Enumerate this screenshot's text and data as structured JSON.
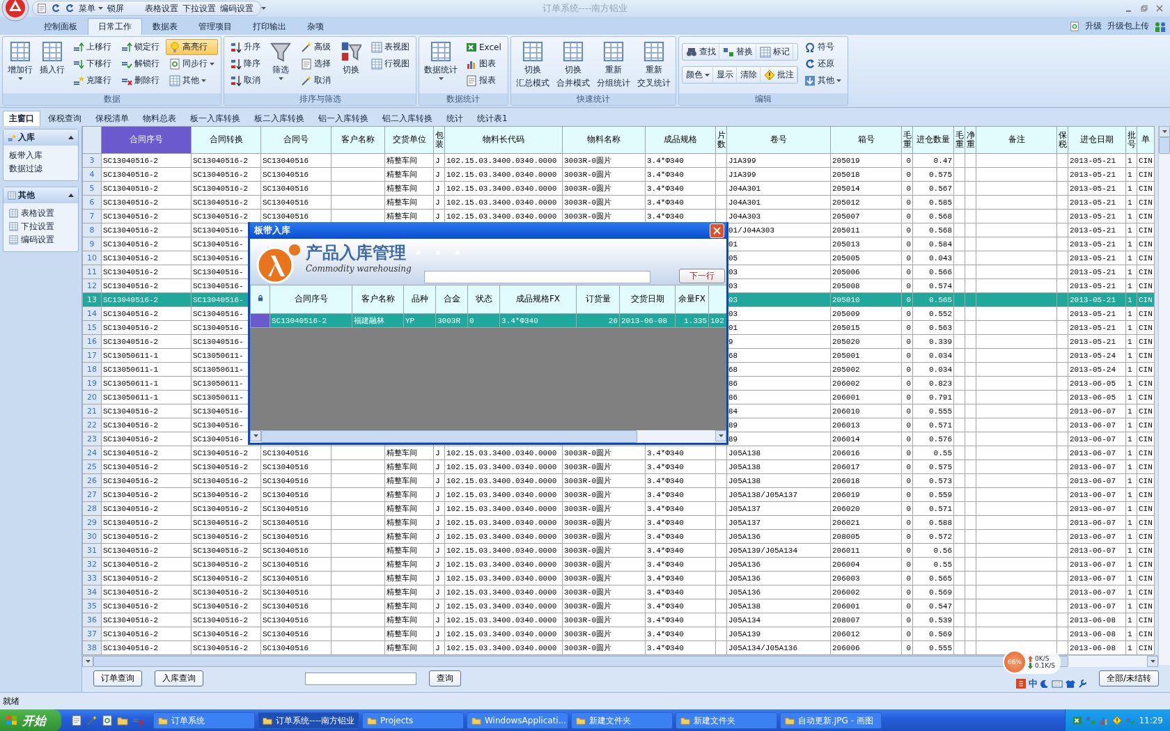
{
  "window": {
    "title": "订单系统----南方铝业"
  },
  "quick_access": [
    {
      "label": "菜单",
      "dropdown": true
    },
    {
      "label": "锁屏",
      "dropdown": false
    },
    {
      "label": "表格设置",
      "dropdown": false
    },
    {
      "label": "下拉设置",
      "dropdown": false
    },
    {
      "label": "编码设置",
      "dropdown": false
    }
  ],
  "menu_tabs": [
    {
      "label": "控制面板",
      "selected": false
    },
    {
      "label": "日常工作",
      "selected": true
    },
    {
      "label": "数据表",
      "selected": false
    },
    {
      "label": "管理项目",
      "selected": false
    },
    {
      "label": "打印输出",
      "selected": false
    },
    {
      "label": "杂项",
      "selected": false
    }
  ],
  "top_right": [
    "升级",
    "升级包上传"
  ],
  "ribbon": [
    {
      "title": "数据",
      "columns": [
        {
          "kind": "large",
          "lines": [
            "增加行"
          ],
          "dropdown": true
        },
        {
          "kind": "large",
          "lines": [
            "插入行"
          ],
          "dropdown": false
        },
        {
          "kind": "stack",
          "items": [
            {
              "label": "上移行",
              "on": false,
              "dropdown": false
            },
            {
              "label": "下移行",
              "on": false,
              "dropdown": false
            },
            {
              "label": "克隆行",
              "on": false,
              "dropdown": false
            }
          ]
        },
        {
          "kind": "stack",
          "items": [
            {
              "label": "锁定行",
              "on": false,
              "dropdown": false
            },
            {
              "label": "解锁行",
              "on": false,
              "dropdown": false
            },
            {
              "label": "删除行",
              "on": false,
              "dropdown": false
            }
          ]
        },
        {
          "kind": "stack",
          "items": [
            {
              "label": "高亮行",
              "on": true,
              "dropdown": false
            },
            {
              "label": "同步行",
              "on": false,
              "dropdown": true
            },
            {
              "label": "其他",
              "on": false,
              "dropdown": true
            }
          ]
        }
      ]
    },
    {
      "title": "排序与筛选",
      "columns": [
        {
          "kind": "stack",
          "items": [
            {
              "label": "升序",
              "on": false,
              "dropdown": false
            },
            {
              "label": "降序",
              "on": false,
              "dropdown": false
            },
            {
              "label": "取消",
              "on": false,
              "dropdown": false
            }
          ]
        },
        {
          "kind": "large",
          "lines": [
            "筛选"
          ],
          "dropdown": true
        },
        {
          "kind": "stack",
          "items": [
            {
              "label": "高级",
              "on": false,
              "dropdown": false
            },
            {
              "label": "选择",
              "on": false,
              "dropdown": false
            },
            {
              "label": "取消",
              "on": false,
              "dropdown": false
            }
          ]
        },
        {
          "kind": "large",
          "lines": [
            "切换"
          ],
          "dropdown": false
        },
        {
          "kind": "stack",
          "items": [
            {
              "label": "表视图",
              "on": false,
              "dropdown": false
            },
            {
              "label": "行视图",
              "on": false,
              "dropdown": false
            }
          ]
        }
      ]
    },
    {
      "title": "数据统计",
      "columns": [
        {
          "kind": "large",
          "lines": [
            "数据统计"
          ],
          "dropdown": true
        },
        {
          "kind": "stack",
          "items": [
            {
              "label": "Excel",
              "on": false,
              "dropdown": false
            },
            {
              "label": "图表",
              "on": false,
              "dropdown": false
            },
            {
              "label": "报表",
              "on": false,
              "dropdown": false
            }
          ]
        }
      ]
    },
    {
      "title": "快速统计",
      "columns": [
        {
          "kind": "large",
          "lines": [
            "切换",
            "汇总模式"
          ],
          "dropdown": false
        },
        {
          "kind": "large",
          "lines": [
            "切换",
            "合并模式"
          ],
          "dropdown": false
        },
        {
          "kind": "large",
          "lines": [
            "重新",
            "分组统计"
          ],
          "dropdown": false
        },
        {
          "kind": "large",
          "lines": [
            "重新",
            "交叉统计"
          ],
          "dropdown": false
        }
      ]
    },
    {
      "title": "编辑",
      "columns": [
        {
          "kind": "strips",
          "strips": [
            {
              "items": [
                {
                  "label": "查找",
                  "dropdown": false
                },
                {
                  "label": "替换",
                  "dropdown": false
                },
                {
                  "label": "标记",
                  "dropdown": false
                }
              ]
            },
            {
              "items": [
                {
                  "label": "颜色",
                  "dropdown": true
                },
                {
                  "label": "显示",
                  "dropdown": false
                },
                {
                  "label": "清除",
                  "dropdown": false
                },
                {
                  "label": "批注",
                  "dropdown": false
                }
              ]
            }
          ]
        },
        {
          "kind": "stack",
          "items": [
            {
              "label": "符号",
              "on": false,
              "dropdown": false
            },
            {
              "label": "还原",
              "on": false,
              "dropdown": false
            },
            {
              "label": "其他",
              "on": false,
              "dropdown": true
            }
          ]
        }
      ]
    }
  ],
  "doc_tabs": [
    {
      "label": "主窗口",
      "selected": true
    },
    {
      "label": "保税查询",
      "selected": false
    },
    {
      "label": "保税清单",
      "selected": false
    },
    {
      "label": "物料总表",
      "selected": false
    },
    {
      "label": "板一入库转换",
      "selected": false
    },
    {
      "label": "板二入库转换",
      "selected": false
    },
    {
      "label": "铝一入库转换",
      "selected": false
    },
    {
      "label": "铝二入库转换",
      "selected": false
    },
    {
      "label": "统计",
      "selected": false
    },
    {
      "label": "统计表1",
      "selected": false
    }
  ],
  "sidebar": [
    {
      "title": "入库",
      "kind": "plain",
      "items": [
        "板带入库",
        "数据过滤"
      ]
    },
    {
      "title": "其他",
      "kind": "icons",
      "items": [
        "表格设置",
        "下拉设置",
        "编码设置"
      ]
    }
  ],
  "table": {
    "columns": [
      {
        "label": "合同序号",
        "selected": true
      },
      {
        "label": "合同转换",
        "selected": false
      },
      {
        "label": "合同号",
        "selected": false
      },
      {
        "label": "客户名称",
        "selected": false
      },
      {
        "label": "交货单位",
        "selected": false
      },
      {
        "label": "包装",
        "selected": false
      },
      {
        "label": "物料长代码",
        "selected": false
      },
      {
        "label": "物料名称",
        "selected": false
      },
      {
        "label": "成品规格",
        "selected": false
      },
      {
        "label": "片数",
        "selected": false
      },
      {
        "label": "卷号",
        "selected": false
      },
      {
        "label": "箱号",
        "selected": false
      },
      {
        "label": "毛重",
        "selected": false
      },
      {
        "label": "进仓数量",
        "selected": false
      },
      {
        "label": "毛重",
        "selected": false
      },
      {
        "label": "净重",
        "selected": false
      },
      {
        "label": "备注",
        "selected": false
      },
      {
        "label": "保税",
        "selected": false
      },
      {
        "label": "进仓日期",
        "selected": false
      },
      {
        "label": "批号",
        "selected": false
      },
      {
        "label": "单",
        "selected": false
      }
    ],
    "rows": [
      {
        "n": "3",
        "selected": false,
        "cells": [
          "SC13040516-2",
          "SC13040516-2",
          "SC13040516",
          null,
          "精整车间",
          "J",
          "102.15.03.3400.0340.0000",
          "3003R-0圆片",
          "3.4*Φ340",
          null,
          "J1A399",
          "205019",
          "0",
          "0.47",
          null,
          null,
          null,
          null,
          "2013-05-21",
          "1",
          "CIN"
        ]
      },
      {
        "n": "4",
        "selected": false,
        "cells": [
          "SC13040516-2",
          "SC13040516-2",
          "SC13040516",
          null,
          "精整车间",
          "J",
          "102.15.03.3400.0340.0000",
          "3003R-0圆片",
          "3.4*Φ340",
          null,
          "J1A399",
          "205018",
          "0",
          "0.575",
          null,
          null,
          null,
          null,
          "2013-05-21",
          "1",
          "CIN"
        ]
      },
      {
        "n": "5",
        "selected": false,
        "cells": [
          "SC13040516-2",
          "SC13040516-2",
          "SC13040516",
          null,
          "精整车间",
          "J",
          "102.15.03.3400.0340.0000",
          "3003R-0圆片",
          "3.4*Φ340",
          null,
          "J04A301",
          "205014",
          "0",
          "0.567",
          null,
          null,
          null,
          null,
          "2013-05-21",
          "1",
          "CIN"
        ]
      },
      {
        "n": "6",
        "selected": false,
        "cells": [
          "SC13040516-2",
          "SC13040516-2",
          "SC13040516",
          null,
          "精整车间",
          "J",
          "102.15.03.3400.0340.0000",
          "3003R-0圆片",
          "3.4*Φ340",
          null,
          "J04A301",
          "205012",
          "0",
          "0.585",
          null,
          null,
          null,
          null,
          "2013-05-21",
          "1",
          "CIN"
        ]
      },
      {
        "n": "7",
        "selected": false,
        "cells": [
          "SC13040516-2",
          "SC13040516-2",
          "SC13040516",
          null,
          "精整车间",
          "J",
          "102.15.03.3400.0340.0000",
          "3003R-0圆片",
          "3.4*Φ340",
          null,
          "J04A303",
          "205007",
          "0",
          "0.568",
          null,
          null,
          null,
          null,
          "2013-05-21",
          "1",
          "CIN"
        ]
      },
      {
        "n": "8",
        "selected": false,
        "cells": [
          "SC13040516-2",
          "SC13040516-",
          null,
          null,
          null,
          null,
          null,
          null,
          null,
          null,
          "01/J04A303",
          "205011",
          "0",
          "0.568",
          null,
          null,
          null,
          null,
          "2013-05-21",
          "1",
          "CIN"
        ]
      },
      {
        "n": "9",
        "selected": false,
        "cells": [
          "SC13040516-2",
          "SC13040516-",
          null,
          null,
          null,
          null,
          null,
          null,
          null,
          null,
          "01",
          "205013",
          "0",
          "0.584",
          null,
          null,
          null,
          null,
          "2013-05-21",
          "1",
          "CIN"
        ]
      },
      {
        "n": "10",
        "selected": false,
        "cells": [
          "SC13040516-2",
          "SC13040516-",
          null,
          null,
          null,
          null,
          null,
          null,
          null,
          null,
          "05",
          "205005",
          "0",
          "0.043",
          null,
          null,
          null,
          null,
          "2013-05-21",
          "1",
          "CIN"
        ]
      },
      {
        "n": "11",
        "selected": false,
        "cells": [
          "SC13040516-2",
          "SC13040516-",
          null,
          null,
          null,
          null,
          null,
          null,
          null,
          null,
          "03",
          "205006",
          "0",
          "0.566",
          null,
          null,
          null,
          null,
          "2013-05-21",
          "1",
          "CIN"
        ]
      },
      {
        "n": "12",
        "selected": false,
        "cells": [
          "SC13040516-2",
          "SC13040516-",
          null,
          null,
          null,
          null,
          null,
          null,
          null,
          null,
          "03",
          "205008",
          "0",
          "0.574",
          null,
          null,
          null,
          null,
          "2013-05-21",
          "1",
          "CIN"
        ]
      },
      {
        "n": "13",
        "selected": true,
        "cells": [
          "SC13040516-2",
          "SC13040516-",
          null,
          null,
          null,
          null,
          null,
          null,
          null,
          null,
          "03",
          "205010",
          "0",
          "0.565",
          null,
          null,
          null,
          null,
          "2013-05-21",
          "1",
          "CIN"
        ]
      },
      {
        "n": "14",
        "selected": false,
        "cells": [
          "SC13040516-2",
          "SC13040516-",
          null,
          null,
          null,
          null,
          null,
          null,
          null,
          null,
          "03",
          "205009",
          "0",
          "0.552",
          null,
          null,
          null,
          null,
          "2013-05-21",
          "1",
          "CIN"
        ]
      },
      {
        "n": "15",
        "selected": false,
        "cells": [
          "SC13040516-2",
          "SC13040516-",
          null,
          null,
          null,
          null,
          null,
          null,
          null,
          null,
          "01",
          "205015",
          "0",
          "0.563",
          null,
          null,
          null,
          null,
          "2013-05-21",
          "1",
          "CIN"
        ]
      },
      {
        "n": "16",
        "selected": false,
        "cells": [
          "SC13040516-2",
          "SC13040516-",
          null,
          null,
          null,
          null,
          null,
          null,
          null,
          null,
          "9",
          "205020",
          "0",
          "0.339",
          null,
          null,
          null,
          null,
          "2013-05-21",
          "1",
          "CIN"
        ]
      },
      {
        "n": "17",
        "selected": false,
        "cells": [
          "SC13050611-1",
          "SC13050611-",
          null,
          null,
          null,
          null,
          null,
          null,
          null,
          null,
          "68",
          "205001",
          "0",
          "0.034",
          null,
          null,
          null,
          null,
          "2013-05-24",
          "1",
          "CIN"
        ]
      },
      {
        "n": "18",
        "selected": false,
        "cells": [
          "SC13050611-1",
          "SC13050611-",
          null,
          null,
          null,
          null,
          null,
          null,
          null,
          null,
          "68",
          "205002",
          "0",
          "0.034",
          null,
          null,
          null,
          null,
          "2013-05-24",
          "1",
          "CIN"
        ]
      },
      {
        "n": "19",
        "selected": false,
        "cells": [
          "SC13050611-1",
          "SC13050611-",
          null,
          null,
          null,
          null,
          null,
          null,
          null,
          null,
          "86",
          "206002",
          "0",
          "0.823",
          null,
          null,
          null,
          null,
          "2013-06-05",
          "1",
          "CIN"
        ]
      },
      {
        "n": "20",
        "selected": false,
        "cells": [
          "SC13050611-1",
          "SC13050611-",
          null,
          null,
          null,
          null,
          null,
          null,
          null,
          null,
          "86",
          "206001",
          "0",
          "0.791",
          null,
          null,
          null,
          null,
          "2013-06-05",
          "1",
          "CIN"
        ]
      },
      {
        "n": "21",
        "selected": false,
        "cells": [
          "SC13040516-2",
          "SC13040516-",
          null,
          null,
          null,
          null,
          null,
          null,
          null,
          null,
          "84",
          "206010",
          "0",
          "0.555",
          null,
          null,
          null,
          null,
          "2013-06-07",
          "1",
          "CIN"
        ]
      },
      {
        "n": "22",
        "selected": false,
        "cells": [
          "SC13040516-2",
          "SC13040516-",
          null,
          null,
          null,
          null,
          null,
          null,
          null,
          null,
          "89",
          "206013",
          "0",
          "0.571",
          null,
          null,
          null,
          null,
          "2013-06-07",
          "1",
          "CIN"
        ]
      },
      {
        "n": "23",
        "selected": false,
        "cells": [
          "SC13040516-2",
          "SC13040516-",
          null,
          null,
          null,
          null,
          null,
          null,
          null,
          null,
          "89",
          "206014",
          "0",
          "0.576",
          null,
          null,
          null,
          null,
          "2013-06-07",
          "1",
          "CIN"
        ]
      },
      {
        "n": "24",
        "selected": false,
        "cells": [
          "SC13040516-2",
          "SC13040516-2",
          "SC13040516",
          null,
          "精整车间",
          "J",
          "102.15.03.3400.0340.0000",
          "3003R-0圆片",
          "3.4*Φ340",
          null,
          "J05A138",
          "206016",
          "0",
          "0.55",
          null,
          null,
          null,
          null,
          "2013-06-07",
          "1",
          "CIN"
        ]
      },
      {
        "n": "25",
        "selected": false,
        "cells": [
          "SC13040516-2",
          "SC13040516-2",
          "SC13040516",
          null,
          "精整车间",
          "J",
          "102.15.03.3400.0340.0000",
          "3003R-0圆片",
          "3.4*Φ340",
          null,
          "J05A138",
          "206017",
          "0",
          "0.575",
          null,
          null,
          null,
          null,
          "2013-06-07",
          "1",
          "CIN"
        ]
      },
      {
        "n": "26",
        "selected": false,
        "cells": [
          "SC13040516-2",
          "SC13040516-2",
          "SC13040516",
          null,
          "精整车间",
          "J",
          "102.15.03.3400.0340.0000",
          "3003R-0圆片",
          "3.4*Φ340",
          null,
          "J05A138",
          "206018",
          "0",
          "0.573",
          null,
          null,
          null,
          null,
          "2013-06-07",
          "1",
          "CIN"
        ]
      },
      {
        "n": "27",
        "selected": false,
        "cells": [
          "SC13040516-2",
          "SC13040516-2",
          "SC13040516",
          null,
          "精整车间",
          "J",
          "102.15.03.3400.0340.0000",
          "3003R-0圆片",
          "3.4*Φ340",
          null,
          "J05A138/J05A137",
          "206019",
          "0",
          "0.559",
          null,
          null,
          null,
          null,
          "2013-06-07",
          "1",
          "CIN"
        ]
      },
      {
        "n": "28",
        "selected": false,
        "cells": [
          "SC13040516-2",
          "SC13040516-2",
          "SC13040516",
          null,
          "精整车间",
          "J",
          "102.15.03.3400.0340.0000",
          "3003R-0圆片",
          "3.4*Φ340",
          null,
          "J05A137",
          "206020",
          "0",
          "0.571",
          null,
          null,
          null,
          null,
          "2013-06-07",
          "1",
          "CIN"
        ]
      },
      {
        "n": "29",
        "selected": false,
        "cells": [
          "SC13040516-2",
          "SC13040516-2",
          "SC13040516",
          null,
          "精整车间",
          "J",
          "102.15.03.3400.0340.0000",
          "3003R-0圆片",
          "3.4*Φ340",
          null,
          "J05A137",
          "206021",
          "0",
          "0.588",
          null,
          null,
          null,
          null,
          "2013-06-07",
          "1",
          "CIN"
        ]
      },
      {
        "n": "30",
        "selected": false,
        "cells": [
          "SC13040516-2",
          "SC13040516-2",
          "SC13040516",
          null,
          "精整车间",
          "J",
          "102.15.03.3400.0340.0000",
          "3003R-0圆片",
          "3.4*Φ340",
          null,
          "J05A136",
          "208005",
          "0",
          "0.572",
          null,
          null,
          null,
          null,
          "2013-06-07",
          "1",
          "CIN"
        ]
      },
      {
        "n": "31",
        "selected": false,
        "cells": [
          "SC13040516-2",
          "SC13040516-2",
          "SC13040516",
          null,
          "精整车间",
          "J",
          "102.15.03.3400.0340.0000",
          "3003R-0圆片",
          "3.4*Φ340",
          null,
          "J05A139/J05A134",
          "206011",
          "0",
          "0.56",
          null,
          null,
          null,
          null,
          "2013-06-07",
          "1",
          "CIN"
        ]
      },
      {
        "n": "32",
        "selected": false,
        "cells": [
          "SC13040516-2",
          "SC13040516-2",
          "SC13040516",
          null,
          "精整车间",
          "J",
          "102.15.03.3400.0340.0000",
          "3003R-0圆片",
          "3.4*Φ340",
          null,
          "J05A136",
          "206004",
          "0",
          "0.55",
          null,
          null,
          null,
          null,
          "2013-06-07",
          "1",
          "CIN"
        ]
      },
      {
        "n": "33",
        "selected": false,
        "cells": [
          "SC13040516-2",
          "SC13040516-2",
          "SC13040516",
          null,
          "精整车间",
          "J",
          "102.15.03.3400.0340.0000",
          "3003R-0圆片",
          "3.4*Φ340",
          null,
          "J05A136",
          "206003",
          "0",
          "0.565",
          null,
          null,
          null,
          null,
          "2013-06-07",
          "1",
          "CIN"
        ]
      },
      {
        "n": "34",
        "selected": false,
        "cells": [
          "SC13040516-2",
          "SC13040516-2",
          "SC13040516",
          null,
          "精整车间",
          "J",
          "102.15.03.3400.0340.0000",
          "3003R-0圆片",
          "3.4*Φ340",
          null,
          "J05A136",
          "206002",
          "0",
          "0.569",
          null,
          null,
          null,
          null,
          "2013-06-07",
          "1",
          "CIN"
        ]
      },
      {
        "n": "35",
        "selected": false,
        "cells": [
          "SC13040516-2",
          "SC13040516-2",
          "SC13040516",
          null,
          "精整车间",
          "J",
          "102.15.03.3400.0340.0000",
          "3003R-0圆片",
          "3.4*Φ340",
          null,
          "J05A138",
          "206001",
          "0",
          "0.547",
          null,
          null,
          null,
          null,
          "2013-06-07",
          "1",
          "CIN"
        ]
      },
      {
        "n": "36",
        "selected": false,
        "cells": [
          "SC13040516-2",
          "SC13040516-2",
          "SC13040516",
          null,
          "精整车间",
          "J",
          "102.15.03.3400.0340.0000",
          "3003R-0圆片",
          "3.4*Φ340",
          null,
          "J05A134",
          "208007",
          "0",
          "0.539",
          null,
          null,
          null,
          null,
          "2013-06-08",
          "1",
          "CIN"
        ]
      },
      {
        "n": "37",
        "selected": false,
        "cells": [
          "SC13040516-2",
          "SC13040516-2",
          "SC13040516",
          null,
          "精整车间",
          "J",
          "102.15.03.3400.0340.0000",
          "3003R-0圆片",
          "3.4*Φ340",
          null,
          "J05A139",
          "206012",
          "0",
          "0.569",
          null,
          null,
          null,
          null,
          "2013-06-08",
          "1",
          "CIN"
        ]
      },
      {
        "n": "38",
        "selected": false,
        "cells": [
          "SC13040516-2",
          "SC13040516-2",
          "SC13040516",
          null,
          "精整车间",
          "J",
          "102.15.03.3400.0340.0000",
          "3003R-0圆片",
          "3.4*Φ340",
          null,
          "J05A134/J05A136",
          "206006",
          "0",
          "0.555",
          null,
          null,
          null,
          null,
          "2013-06-08",
          "1",
          "CIN"
        ]
      }
    ]
  },
  "bottom_bar": {
    "buttons": [
      "订单查询",
      "入库查询"
    ],
    "search_button": "查询",
    "right_button": "全部/未结转"
  },
  "net_monitor": {
    "percent": "66%",
    "upload": "0K/S",
    "download": "0.1K/S"
  },
  "ime": {
    "label": "中"
  },
  "status_bar": "就绪",
  "taskbar": {
    "start": "开始",
    "items": [
      {
        "label": "订单系统",
        "selected": false
      },
      {
        "label": "订单系统----南方铝业",
        "selected": true
      },
      {
        "label": "Projects",
        "selected": false
      },
      {
        "label": "WindowsApplicati...",
        "selected": false
      },
      {
        "label": "新建文件夹",
        "selected": false
      },
      {
        "label": "新建文件夹",
        "selected": false
      },
      {
        "label": "自动更新.JPG - 画图",
        "selected": false
      }
    ],
    "clock": "11:29"
  },
  "dialog": {
    "title": "板带入库",
    "banner_title": "产品入库管理",
    "banner_subtitle": "Commodity warehousing",
    "next_button": "下一行",
    "columns": [
      "合同序号",
      "客户名称",
      "品种",
      "合金",
      "状态",
      "成品规格FX",
      "订货量",
      "交货日期",
      "余量FX"
    ],
    "rows": [
      {
        "cells": [
          "SC13040516-2",
          "福建融林",
          "YP",
          "3003R",
          "0",
          "3.4*Φ340",
          "26",
          "2013-06-08",
          "1.335",
          "102"
        ],
        "selected": true
      }
    ]
  }
}
